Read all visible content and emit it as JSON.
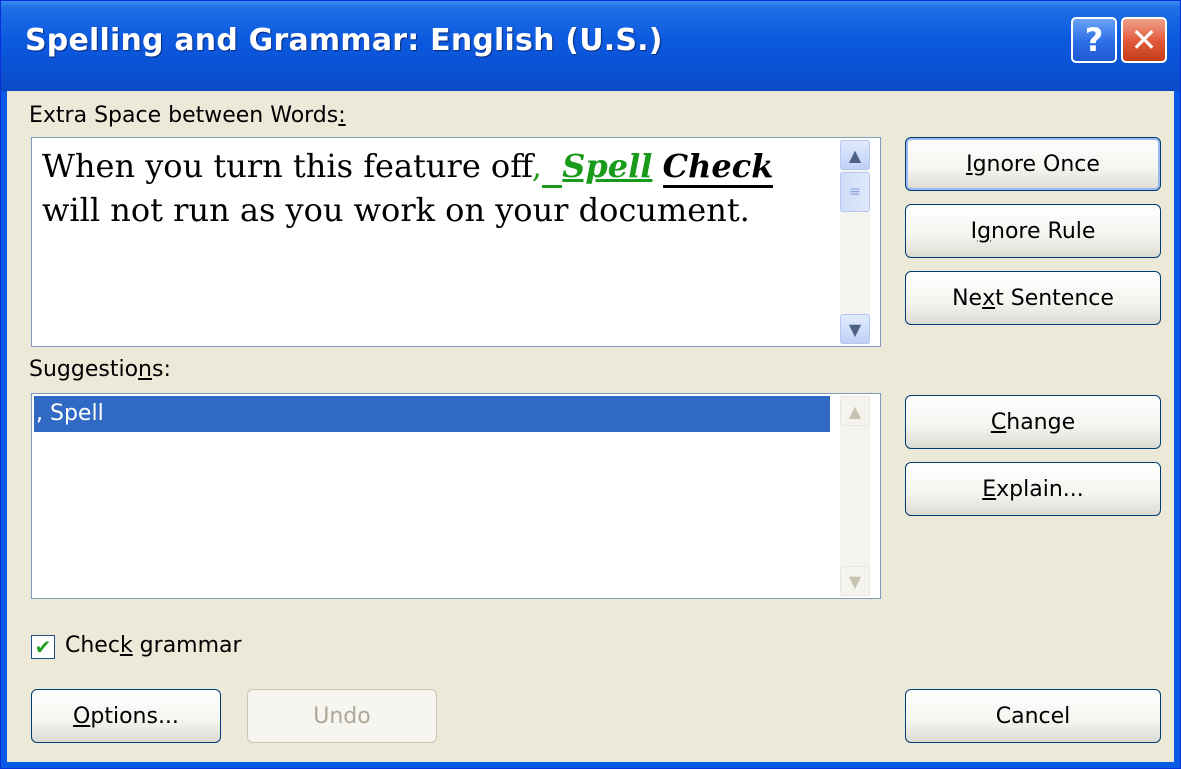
{
  "window": {
    "title": "Spelling and Grammar: English (U.S.)",
    "help_label": "?",
    "close_label": "✕"
  },
  "problem": {
    "label_text": "Extra Space between Words",
    "label_accel": ":",
    "sentence": {
      "part1": "When you turn this feature off",
      "comma": ",",
      "space": "  ",
      "word1": "Spell",
      "word2": "Check",
      "part2": "will not run as you work on your document."
    }
  },
  "suggestions": {
    "label_pre": "Suggestio",
    "label_accel": "n",
    "label_post": "s:",
    "items": [
      ", Spell"
    ]
  },
  "buttons": {
    "ignore_once": {
      "pre": "",
      "accel": "I",
      "post": "gnore Once"
    },
    "ignore_rule": {
      "pre": "I",
      "accel": "g",
      "post": "nore Rule"
    },
    "next_sentence": {
      "pre": "Ne",
      "accel": "x",
      "post": "t Sentence"
    },
    "change": {
      "pre": "",
      "accel": "C",
      "post": "hange"
    },
    "explain": {
      "pre": "",
      "accel": "E",
      "post": "xplain..."
    },
    "options": {
      "pre": "",
      "accel": "O",
      "post": "ptions..."
    },
    "undo": "Undo",
    "cancel": "Cancel"
  },
  "check_grammar": {
    "pre": "Chec",
    "accel": "k",
    "post": " grammar",
    "checked": true,
    "check_glyph": "✔"
  },
  "icons": {
    "scroll_up": "▲",
    "scroll_down": "▼",
    "thumb_grip": "≡"
  },
  "colors": {
    "titlebar": "#0a52d6",
    "selection": "#316ac5",
    "grammar_error": "#1a9a1a",
    "face": "#ece9d8"
  }
}
